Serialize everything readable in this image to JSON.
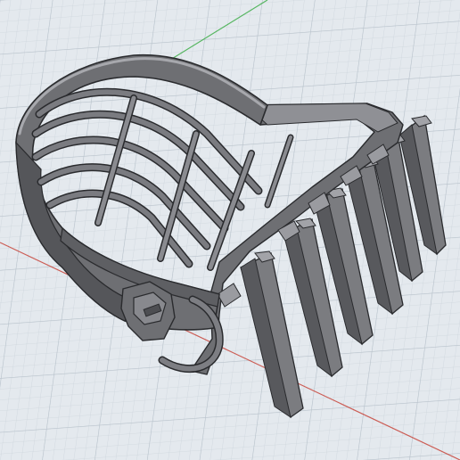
{
  "viewport": {
    "background": "#e4e9ee",
    "grid_minor_color": "#cdd5dc",
    "grid_major_color": "#b9c3cc",
    "axis_x_color": "#c8463c",
    "axis_y_color": "#3fae4a"
  },
  "model": {
    "icon": "hair-clipper-comb-attachment-icon",
    "body_color": "#6e6f73",
    "shade_color": "#4d4e52",
    "highlight_color": "#9a9ba0",
    "edge_color": "#2a2b2e",
    "teeth_count": 6
  }
}
